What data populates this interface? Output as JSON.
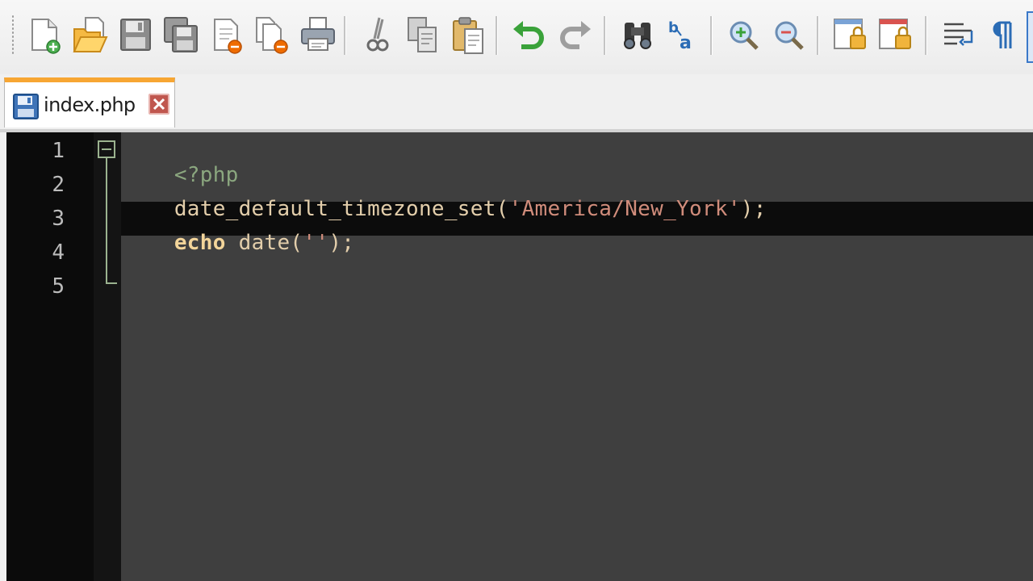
{
  "toolbar": {
    "buttons": [
      {
        "name": "new-file-icon"
      },
      {
        "name": "open-file-icon"
      },
      {
        "name": "save-icon"
      },
      {
        "name": "save-all-icon"
      },
      {
        "name": "close-icon"
      },
      {
        "name": "close-all-icon"
      },
      {
        "name": "print-icon"
      },
      {
        "name": "cut-icon"
      },
      {
        "name": "copy-icon"
      },
      {
        "name": "paste-icon"
      },
      {
        "name": "undo-icon"
      },
      {
        "name": "redo-icon"
      },
      {
        "name": "find-icon"
      },
      {
        "name": "replace-icon"
      },
      {
        "name": "zoom-in-icon"
      },
      {
        "name": "zoom-out-icon"
      },
      {
        "name": "sync-vertical-icon"
      },
      {
        "name": "sync-horizontal-icon"
      },
      {
        "name": "word-wrap-icon"
      },
      {
        "name": "show-all-characters-icon"
      }
    ]
  },
  "tabs": [
    {
      "label": "index.php",
      "active": true
    }
  ],
  "editor": {
    "line_numbers": [
      "1",
      "2",
      "3",
      "4",
      "5"
    ],
    "current_line": 3,
    "lines": [
      [
        {
          "text": "<?php",
          "kind": "tag"
        }
      ],
      [
        {
          "text": "date_default_timezone_set(",
          "kind": "plain"
        },
        {
          "text": "'America/New_York'",
          "kind": "string"
        },
        {
          "text": ");",
          "kind": "plain"
        }
      ],
      [
        {
          "text": "echo",
          "kind": "keyword"
        },
        {
          "text": " date(",
          "kind": "plain"
        },
        {
          "text": "''",
          "kind": "string"
        },
        {
          "text": ");",
          "kind": "plain"
        }
      ],
      [],
      []
    ]
  },
  "colors": {
    "editor_background": "#3f3f3f",
    "gutter_background": "#0b0b0b",
    "current_line": "#0c0c0c",
    "tab_accent": "#f7a633",
    "php_tag": "#8ba77f",
    "string": "#d08c7b",
    "keyword": "#f3d59a",
    "text": "#e3ceab"
  }
}
